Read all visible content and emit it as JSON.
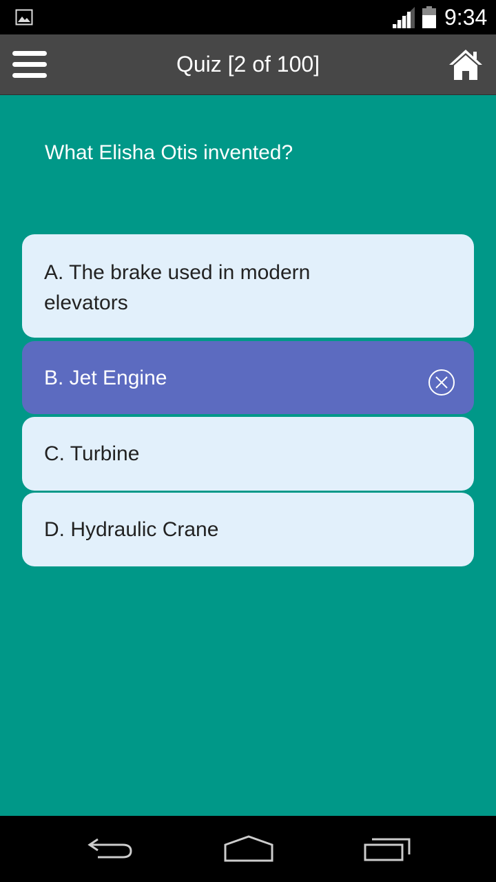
{
  "status_bar": {
    "time": "9:34",
    "icons": [
      "image-notification-icon",
      "signal-icon",
      "battery-icon"
    ]
  },
  "app_bar": {
    "title": "Quiz [2 of 100]",
    "icons": [
      "hamburger-menu-icon",
      "home-icon"
    ]
  },
  "quiz": {
    "question": "What Elisha Otis invented?",
    "options": [
      {
        "label": "A. The brake used in modern elevators",
        "state": "normal"
      },
      {
        "label": "B. Jet Engine",
        "state": "selected-wrong"
      },
      {
        "label": "C. Turbine",
        "state": "normal"
      },
      {
        "label": "D. Hydraulic Crane",
        "state": "normal"
      }
    ]
  },
  "nav_bar": {
    "icons": [
      "back-icon",
      "home-nav-icon",
      "recent-apps-icon"
    ]
  },
  "colors": {
    "content_bg": "#009888",
    "app_bar_bg": "#474747",
    "option_bg": "#e2f0fb",
    "selected_option_bg": "#5c6bc0"
  }
}
